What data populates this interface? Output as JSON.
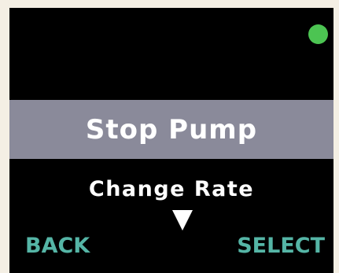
{
  "status": {
    "indicator_icon": "status-dot-icon",
    "indicator_color": "#4cc452"
  },
  "menu": {
    "selected_item": "Stop Pump",
    "next_item": "Change Rate",
    "scroll_icon": "down-triangle-icon"
  },
  "softkeys": {
    "left_label": "BACK",
    "right_label": "SELECT",
    "color": "#55b5a6"
  }
}
